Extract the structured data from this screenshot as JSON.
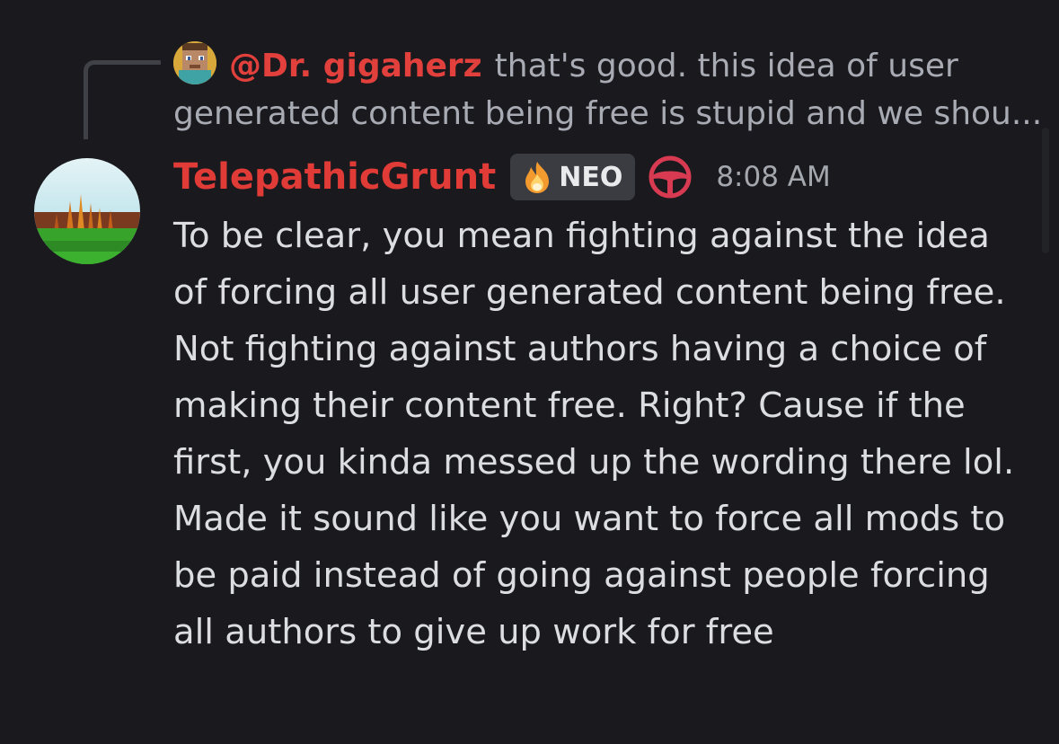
{
  "reply": {
    "author": "@Dr. gigaherz",
    "text_line1": "that's good. this idea of user",
    "text_line2": "generated content being free is stupid and we shou...",
    "avatar_icon": "pixel-character-avatar-icon"
  },
  "message": {
    "author": "TelepathicGrunt",
    "tag_icon": "fire-icon",
    "tag_label": "NEO",
    "role_icon": "steering-wheel-icon",
    "timestamp": "8:08 AM",
    "avatar_icon": "temple-landscape-avatar",
    "body": "To be clear, you mean fighting against the idea of forcing all user generated content being free. Not fighting against authors having a choice of making their content free. Right? Cause if the first, you kinda messed up the wording there lol. Made it sound like you want to force all mods to be paid instead of going against people forcing all authors to give up work for free"
  },
  "colors": {
    "background": "#1a1a1e",
    "username": "#e03b36",
    "reply_author": "#e2403c",
    "message_text": "#dcdde0",
    "muted_text": "#a8abb3",
    "tag_background": "#3a3c42",
    "role_icon": "#d83a52"
  }
}
